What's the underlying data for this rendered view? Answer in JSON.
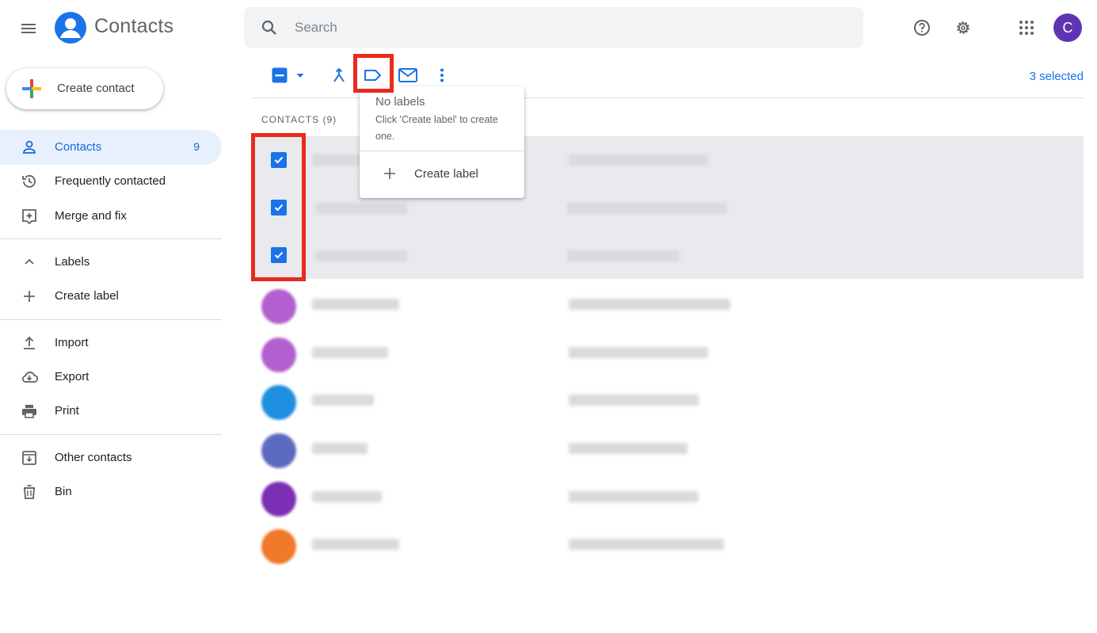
{
  "header": {
    "app_title": "Contacts",
    "search_placeholder": "Search",
    "avatar_letter": "C",
    "icons": [
      "menu-icon",
      "contacts-logo-icon",
      "search-icon",
      "help-icon",
      "settings-icon",
      "apps-grid-icon"
    ]
  },
  "sidebar": {
    "create_contact_label": "Create contact",
    "items": [
      {
        "label": "Contacts",
        "count": "9",
        "icon": "person-icon",
        "active": true
      },
      {
        "label": "Frequently contacted",
        "icon": "history-icon"
      },
      {
        "label": "Merge and fix",
        "icon": "merge-fix-icon"
      },
      {
        "label": "Labels",
        "icon": "chevron-up-icon"
      },
      {
        "label": "Create label",
        "icon": "plus-icon"
      },
      {
        "label": "Import",
        "icon": "upload-icon"
      },
      {
        "label": "Export",
        "icon": "cloud-download-icon"
      },
      {
        "label": "Print",
        "icon": "print-icon"
      },
      {
        "label": "Other contacts",
        "icon": "archive-icon"
      },
      {
        "label": "Bin",
        "icon": "trash-icon"
      }
    ]
  },
  "toolbar": {
    "selected_text": "3 selected",
    "icons": [
      "select-checkbox-icon",
      "dropdown-arrow-icon",
      "merge-icon",
      "label-icon",
      "email-icon",
      "more-vert-icon"
    ]
  },
  "list": {
    "header": "CONTACTS (9)",
    "rows": [
      {
        "selected": true
      },
      {
        "selected": true
      },
      {
        "selected": true
      },
      {
        "selected": false,
        "avatar_color": "#b45fd0"
      },
      {
        "selected": false,
        "avatar_color": "#b45fd0"
      },
      {
        "selected": false,
        "avatar_color": "#1e8fe0"
      },
      {
        "selected": false,
        "avatar_color": "#5c6bc0"
      },
      {
        "selected": false,
        "avatar_color": "#7b2fb5"
      },
      {
        "selected": false,
        "avatar_color": "#f0792a"
      }
    ]
  },
  "label_menu": {
    "title": "No labels",
    "hint": "Click 'Create label' to create one.",
    "create_label": "Create label"
  },
  "colors": {
    "accent": "#1a73e8",
    "highlight": "#ea2a1c",
    "selected_row": "#e8eaed"
  }
}
